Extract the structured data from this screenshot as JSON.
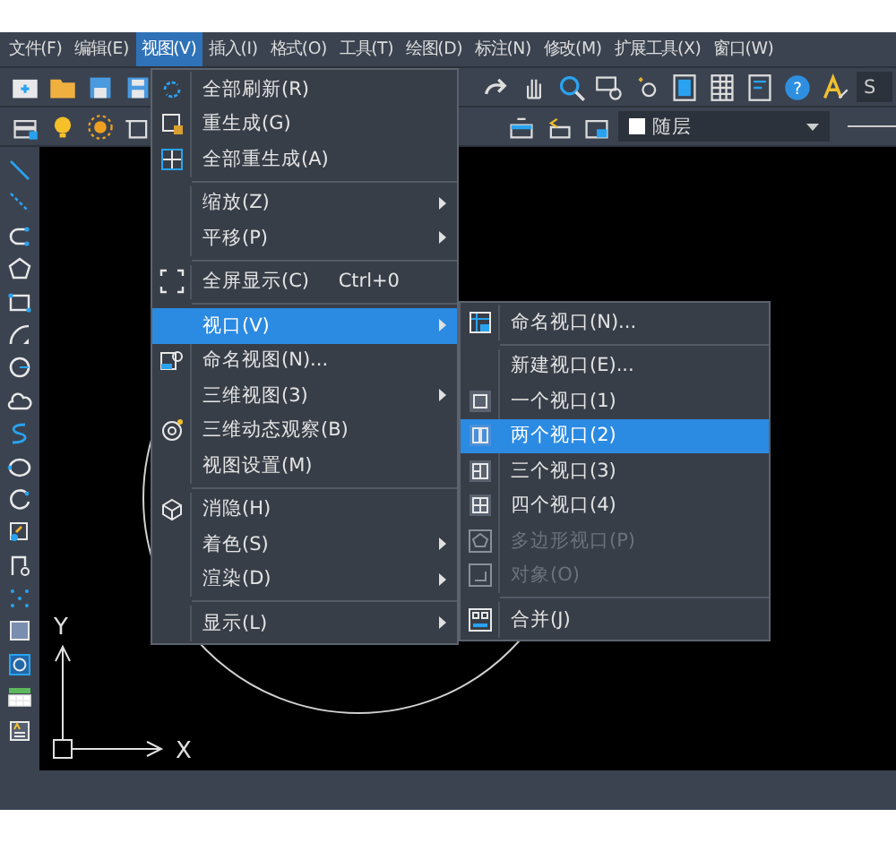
{
  "menu_bar": {
    "items": [
      {
        "label": "文件(F)",
        "selected": false
      },
      {
        "label": "编辑(E)",
        "selected": false
      },
      {
        "label": "视图(V)",
        "selected": true
      },
      {
        "label": "插入(I)",
        "selected": false
      },
      {
        "label": "格式(O)",
        "selected": false
      },
      {
        "label": "工具(T)",
        "selected": false
      },
      {
        "label": "绘图(D)",
        "selected": false
      },
      {
        "label": "标注(N)",
        "selected": false
      },
      {
        "label": "修改(M)",
        "selected": false
      },
      {
        "label": "扩展工具(X)",
        "selected": false
      },
      {
        "label": "窗口(W)",
        "selected": false
      }
    ]
  },
  "toolbar": {
    "help_glyph": "?",
    "text_style": {
      "value": "S"
    },
    "layer": {
      "value": "随层"
    }
  },
  "view_menu": {
    "items": [
      {
        "kind": "item",
        "label": "全部刷新(R)",
        "icon": true,
        "submenu": false,
        "selected": false,
        "disabled": false
      },
      {
        "kind": "item",
        "label": "重生成(G)",
        "icon": true,
        "submenu": false,
        "selected": false,
        "disabled": false
      },
      {
        "kind": "item",
        "label": "全部重生成(A)",
        "icon": true,
        "submenu": false,
        "selected": false,
        "disabled": false
      },
      {
        "kind": "separator"
      },
      {
        "kind": "item",
        "label": "缩放(Z)",
        "icon": false,
        "submenu": true,
        "selected": false,
        "disabled": false
      },
      {
        "kind": "item",
        "label": "平移(P)",
        "icon": false,
        "submenu": true,
        "selected": false,
        "disabled": false
      },
      {
        "kind": "separator"
      },
      {
        "kind": "item",
        "label": "全屏显示(C)",
        "shortcut": "Ctrl+0",
        "icon": true,
        "submenu": false,
        "selected": false,
        "disabled": false
      },
      {
        "kind": "separator"
      },
      {
        "kind": "item",
        "label": "视口(V)",
        "icon": false,
        "submenu": true,
        "selected": true,
        "disabled": false
      },
      {
        "kind": "item",
        "label": "命名视图(N)...",
        "icon": true,
        "submenu": false,
        "selected": false,
        "disabled": false
      },
      {
        "kind": "item",
        "label": "三维视图(3)",
        "icon": false,
        "submenu": true,
        "selected": false,
        "disabled": false
      },
      {
        "kind": "item",
        "label": "三维动态观察(B)",
        "icon": true,
        "submenu": false,
        "selected": false,
        "disabled": false
      },
      {
        "kind": "item",
        "label": "视图设置(M)",
        "icon": false,
        "submenu": false,
        "selected": false,
        "disabled": false
      },
      {
        "kind": "separator"
      },
      {
        "kind": "item",
        "label": "消隐(H)",
        "icon": true,
        "submenu": false,
        "selected": false,
        "disabled": false
      },
      {
        "kind": "item",
        "label": "着色(S)",
        "icon": false,
        "submenu": true,
        "selected": false,
        "disabled": false
      },
      {
        "kind": "item",
        "label": "渲染(D)",
        "icon": false,
        "submenu": true,
        "selected": false,
        "disabled": false
      },
      {
        "kind": "separator"
      },
      {
        "kind": "item",
        "label": "显示(L)",
        "icon": false,
        "submenu": true,
        "selected": false,
        "disabled": false
      }
    ]
  },
  "viewport_submenu": {
    "items": [
      {
        "kind": "item",
        "label": "命名视口(N)...",
        "icon": true,
        "submenu": false,
        "selected": false,
        "disabled": false
      },
      {
        "kind": "separator"
      },
      {
        "kind": "item",
        "label": "新建视口(E)...",
        "icon": false,
        "submenu": false,
        "selected": false,
        "disabled": false
      },
      {
        "kind": "item",
        "label": "一个视口(1)",
        "icon": true,
        "submenu": false,
        "selected": false,
        "disabled": false
      },
      {
        "kind": "item",
        "label": "两个视口(2)",
        "icon": true,
        "submenu": false,
        "selected": true,
        "disabled": false
      },
      {
        "kind": "item",
        "label": "三个视口(3)",
        "icon": true,
        "submenu": false,
        "selected": false,
        "disabled": false
      },
      {
        "kind": "item",
        "label": "四个视口(4)",
        "icon": true,
        "submenu": false,
        "selected": false,
        "disabled": false
      },
      {
        "kind": "item",
        "label": "多边形视口(P)",
        "icon": true,
        "submenu": false,
        "selected": false,
        "disabled": true
      },
      {
        "kind": "item",
        "label": "对象(O)",
        "icon": true,
        "submenu": false,
        "selected": false,
        "disabled": true
      },
      {
        "kind": "separator"
      },
      {
        "kind": "item",
        "label": "合并(J)",
        "icon": true,
        "submenu": false,
        "selected": false,
        "disabled": false
      }
    ]
  },
  "canvas": {
    "ucs": {
      "x_label": "X",
      "y_label": "Y"
    }
  }
}
